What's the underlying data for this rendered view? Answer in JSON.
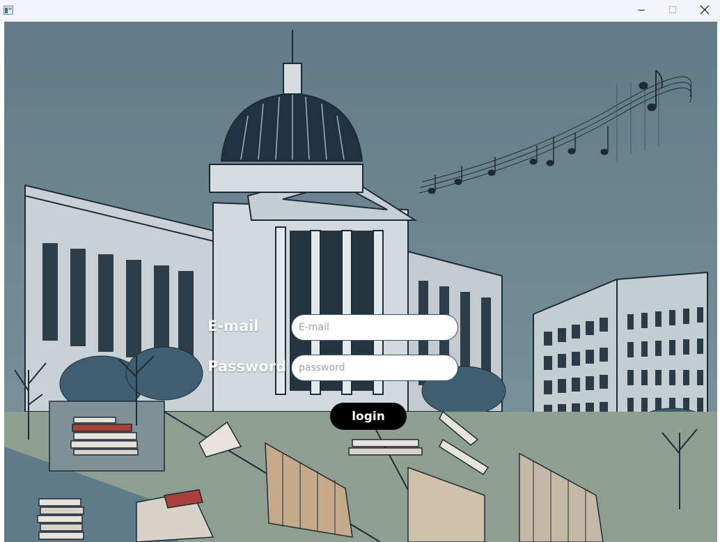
{
  "window": {
    "icon": "app-window-icon",
    "controls": [
      "minimize-icon",
      "maximize-icon",
      "close-icon"
    ]
  },
  "background": {
    "description_icon": "campus-illustration",
    "colors": {
      "sky": "#6f8895",
      "ground": "#8e9f92",
      "building": "#c9d1d6",
      "ink": "#1e2b36"
    }
  },
  "login_form": {
    "email_label": "E-mail",
    "email_placeholder": "E-mail",
    "email_value": "",
    "password_label": "Password",
    "password_placeholder": "password",
    "password_value": "",
    "login_button": "login"
  }
}
